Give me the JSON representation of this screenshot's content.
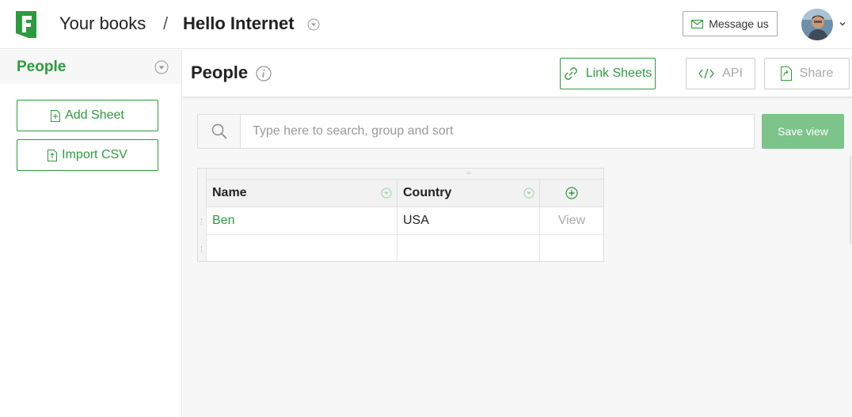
{
  "header": {
    "breadcrumb_books": "Your books",
    "breadcrumb_separator": "/",
    "breadcrumb_document": "Hello Internet",
    "message_button": "Message us"
  },
  "sidebar": {
    "title": "People",
    "add_sheet": "Add Sheet",
    "import_csv": "Import CSV"
  },
  "main": {
    "title": "People",
    "buttons": {
      "link_sheets": "Link Sheets",
      "api": "API",
      "share": "Share"
    },
    "search": {
      "placeholder": "Type here to search, group and sort",
      "value": ""
    },
    "save_view": "Save view"
  },
  "table": {
    "columns": [
      "Name",
      "Country"
    ],
    "rows": [
      {
        "name": "Ben",
        "country": "USA",
        "action": "View"
      }
    ]
  },
  "colors": {
    "accent": "#2e9a3f",
    "save_button": "#7cc48a"
  },
  "icons": [
    "logo-icon",
    "chevron-down-icon",
    "envelope-icon",
    "info-icon",
    "link-icon",
    "code-icon",
    "share-icon",
    "search-icon",
    "add-column-icon",
    "add-sheet-icon",
    "import-icon"
  ]
}
